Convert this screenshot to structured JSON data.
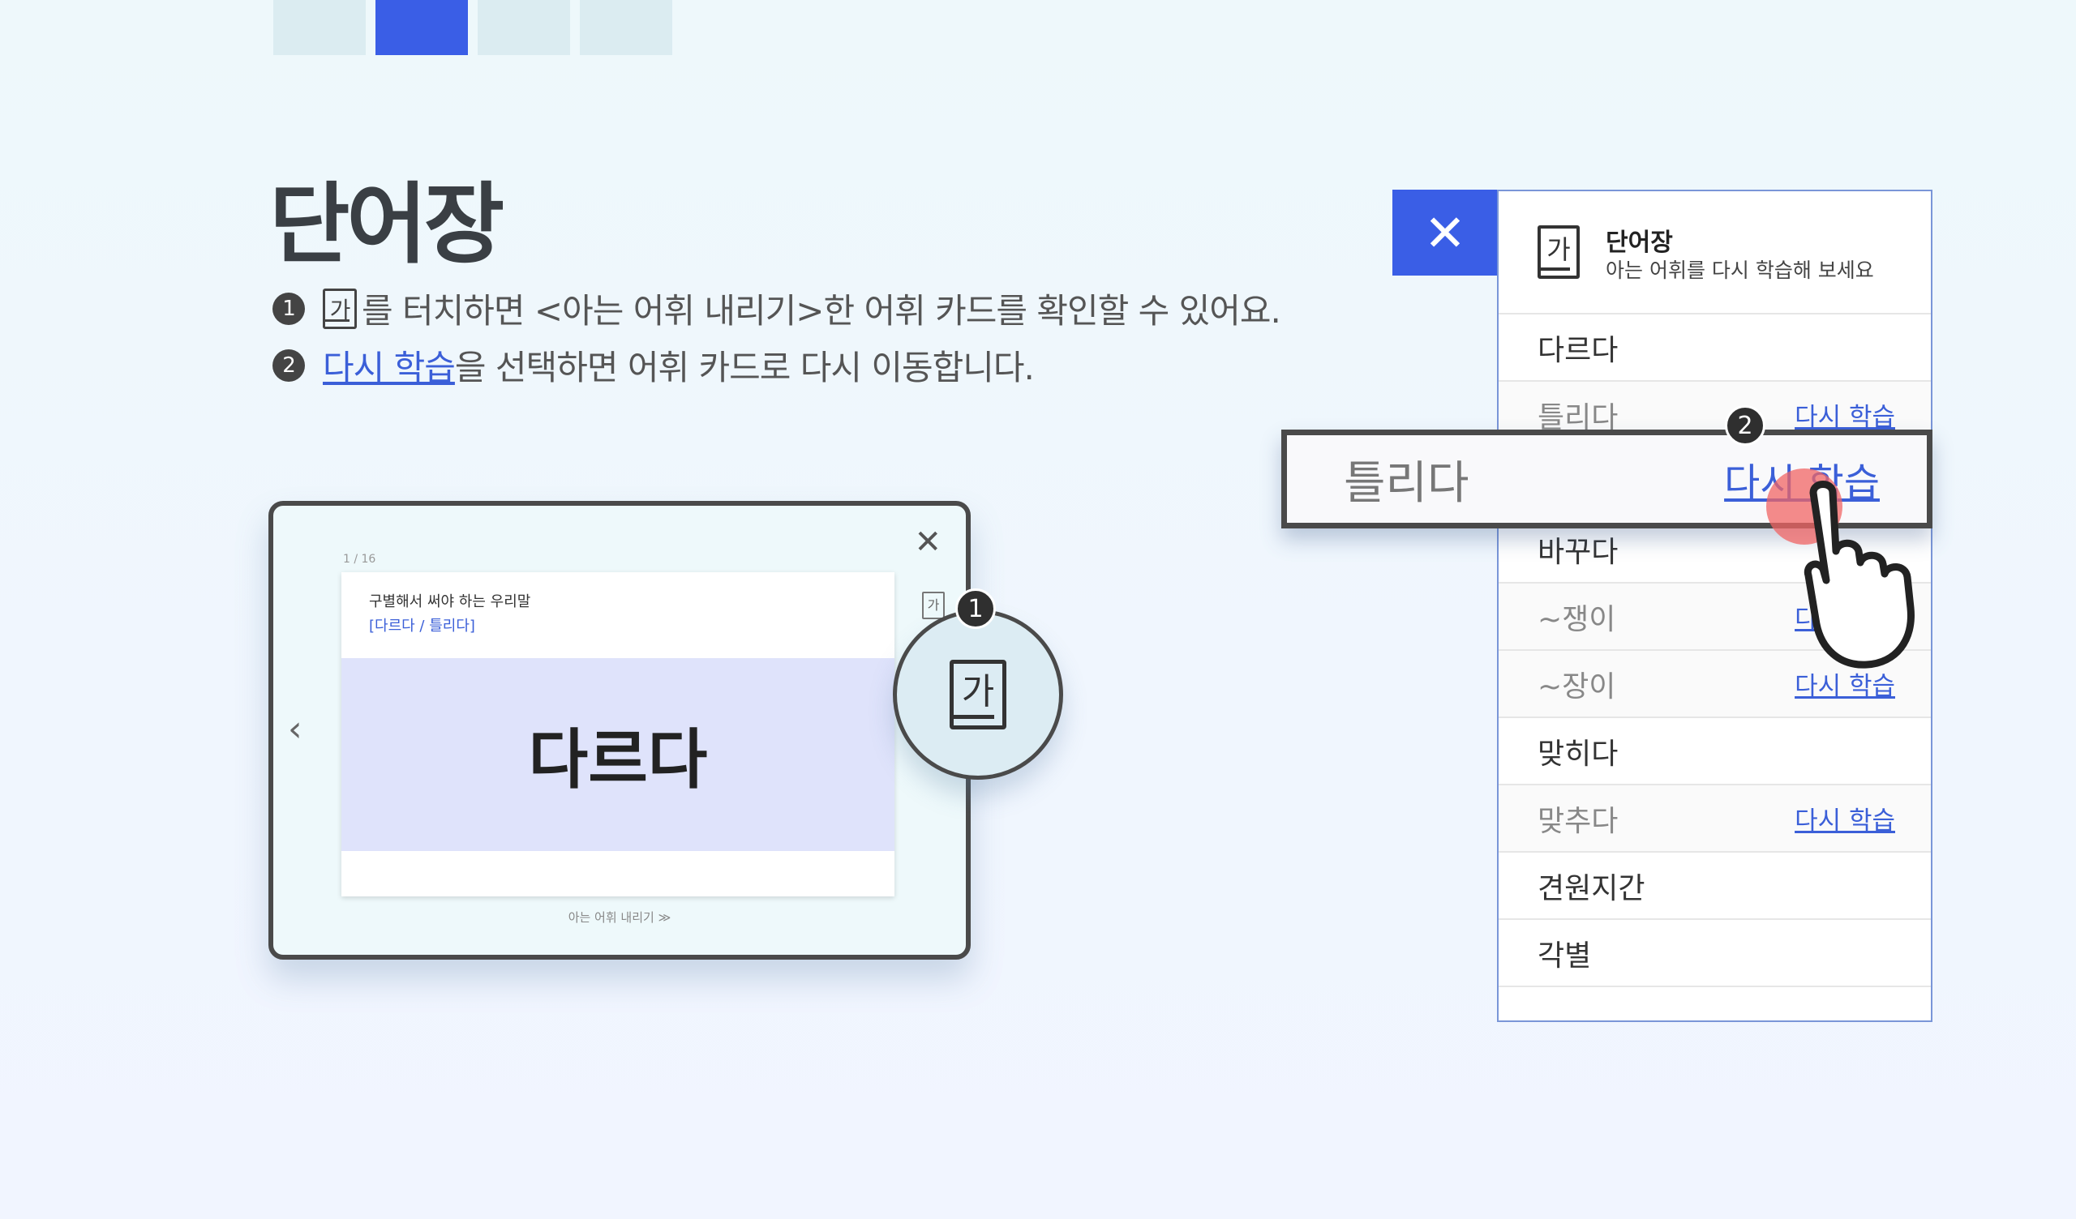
{
  "page": {
    "title": "단어장",
    "instruction1": {
      "number": "1",
      "icon_glyph": "가",
      "text": "를 터치하면 <아는 어휘 내리기>한 어휘 카드를 확인할 수 있어요."
    },
    "instruction2": {
      "number": "2",
      "link": "다시 학습",
      "text": "을 선택하면 어휘 카드로 다시 이동합니다."
    }
  },
  "mini_app": {
    "close": "✕",
    "counter": "1 / 16",
    "card_heading": "구별해서 써야 하는 우리말",
    "card_sub": "[다르다 / 틀리다]",
    "card_word": "다르다",
    "prev": "‹",
    "ga": "가",
    "footer": "아는 어휘 내리기  ≫"
  },
  "zoom_icon": {
    "glyph": "가"
  },
  "callouts": {
    "one": "1",
    "two": "2"
  },
  "panel": {
    "close": "✕",
    "book_glyph": "가",
    "title": "단어장",
    "desc": "아는 어휘를 다시 학습해 보세요",
    "rows": [
      {
        "word": "다르다",
        "known": true,
        "action": ""
      },
      {
        "word": "틀리다",
        "known": false,
        "action": "다시 학습"
      },
      {
        "word": "",
        "known": false,
        "action": ""
      },
      {
        "word": "바꾸다",
        "known": true,
        "action": ""
      },
      {
        "word": "~쟁이",
        "known": false,
        "action": "다시 학습"
      },
      {
        "word": "~장이",
        "known": false,
        "action": "다시 학습"
      },
      {
        "word": "맞히다",
        "known": true,
        "action": ""
      },
      {
        "word": "맞추다",
        "known": false,
        "action": "다시 학습"
      },
      {
        "word": "견원지간",
        "known": true,
        "action": ""
      },
      {
        "word": "각별",
        "known": true,
        "action": ""
      }
    ],
    "zoom_row": {
      "word": "틀리다",
      "action": "다시 학습"
    }
  },
  "colors": {
    "accent": "#3a5ee6",
    "link": "#3b5fd8"
  }
}
